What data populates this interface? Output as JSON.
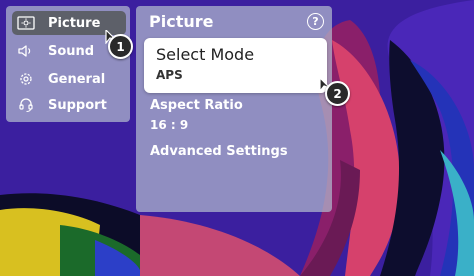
{
  "sidebar": {
    "items": [
      {
        "label": "Picture",
        "icon": "picture-icon",
        "active": true
      },
      {
        "label": "Sound",
        "icon": "speaker-icon",
        "active": false
      },
      {
        "label": "General",
        "icon": "gear-icon",
        "active": false
      },
      {
        "label": "Support",
        "icon": "headset-icon",
        "active": false
      }
    ]
  },
  "panel": {
    "title": "Picture",
    "help_icon": "?",
    "select_mode": {
      "label": "Select Mode",
      "value": "APS"
    },
    "aspect_ratio": {
      "label": "Aspect Ratio",
      "value": "16 : 9"
    },
    "advanced": {
      "label": "Advanced Settings"
    }
  },
  "callouts": {
    "step1": "1",
    "step2": "2"
  },
  "colors": {
    "panel_bg": "#b2bace",
    "active_item": "#5d6069",
    "background_purple": "#3a1f9c"
  }
}
